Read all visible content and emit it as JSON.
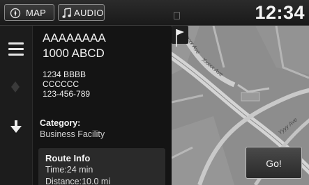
{
  "header": {
    "map_tab": "MAP",
    "audio_tab": "AUDIO",
    "clock": "12:34"
  },
  "destination": {
    "name": "AAAAAAAA",
    "subtitle": "1000 ABCD",
    "address_lines": [
      "1234 BBBB",
      "CCCCCC",
      "123-456-789"
    ],
    "category_label": "Category:",
    "category_value": "Business Facility"
  },
  "route": {
    "title": "Route Info",
    "time": "Time:24 min",
    "distance": "Distance:10.0 mi"
  },
  "map": {
    "streets": [
      "Xxxxx Ave",
      "Xxxxx Ave",
      "Yyyy Ave"
    ],
    "go_label": "Go!"
  }
}
